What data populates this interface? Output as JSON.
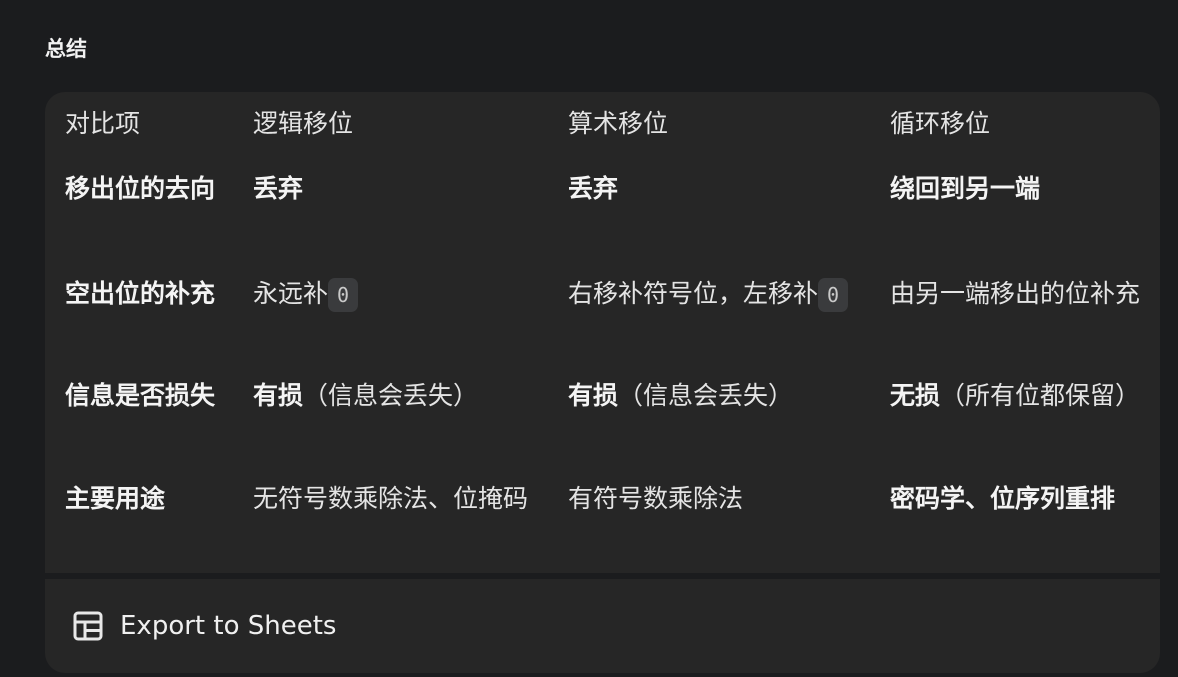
{
  "section": {
    "title": "总结"
  },
  "table": {
    "headers": [
      "对比项",
      "逻辑移位",
      "算术移位",
      "循环移位"
    ],
    "rows": [
      {
        "label": "移出位的去向",
        "c1": "丢弃",
        "c2": "丢弃",
        "c3": "绕回到另一端"
      },
      {
        "label": "空出位的补充",
        "c1_text": "永远补",
        "c1_code": "0",
        "c2_text": "右移补符号位，左移补",
        "c2_code": "0",
        "c3": "由另一端移出的位补充"
      },
      {
        "label": "信息是否损失",
        "c1_bold": "有损",
        "c1_rest": "（信息会丢失）",
        "c2_bold": "有损",
        "c2_rest": "（信息会丢失）",
        "c3_bold": "无损",
        "c3_rest": "（所有位都保留）"
      },
      {
        "label": "主要用途",
        "c1": "无符号数乘除法、位掩码",
        "c2": "有符号数乘除法",
        "c3": "密码学、位序列重排"
      }
    ]
  },
  "footer": {
    "export_label": "Export to Sheets",
    "export_icon": "table-grid-icon"
  }
}
